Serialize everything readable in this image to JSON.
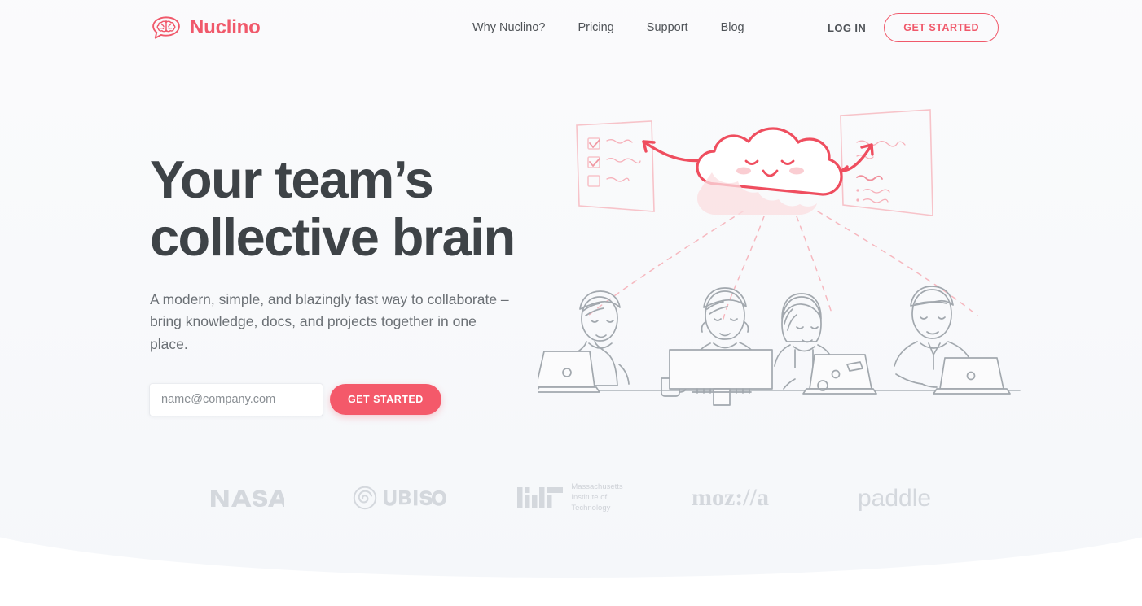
{
  "brand": {
    "name": "Nuclino",
    "icon": "brain-speech-bubble-icon",
    "color": "#f0596b"
  },
  "nav": {
    "items": [
      {
        "label": "Why Nuclino?"
      },
      {
        "label": "Pricing"
      },
      {
        "label": "Support"
      },
      {
        "label": "Blog"
      }
    ]
  },
  "header_actions": {
    "login_label": "LOG IN",
    "get_started_label": "GET STARTED"
  },
  "hero": {
    "headline_line1": "Your team’s",
    "headline_line2": "collective brain",
    "subhead_line1": "A modern, simple, and blazingly fast way to collaborate –",
    "subhead_line2": "bring knowledge, docs, and projects together in one place.",
    "email_placeholder": "name@company.com",
    "email_value": "",
    "cta_label": "GET STARTED"
  },
  "illustration": {
    "alt": "Smiling cloud mascot connected by dashed arcs to four people working on laptops, flanked by a checklist card and a notes card",
    "cloud_color": "#ef4e5f",
    "arc_color": "#f6b8bf",
    "people_color": "#9aa0a6",
    "card_color": "#f7c3c9"
  },
  "logos": {
    "items": [
      {
        "name": "nasa-logo",
        "label": "NASA"
      },
      {
        "name": "ubisoft-logo",
        "label": "UBISOFT"
      },
      {
        "name": "mit-logo",
        "label": "MIT",
        "sub_line1": "Massachusetts",
        "sub_line2": "Institute of",
        "sub_line3": "Technology"
      },
      {
        "name": "mozilla-logo",
        "label": "moz://a"
      },
      {
        "name": "paddle-logo",
        "label": "paddle"
      }
    ],
    "color": "#d3d7dc"
  },
  "colors": {
    "accent": "#f0596b",
    "cta": "#f4596a",
    "heading": "#3e4347",
    "body_text": "#6b7075",
    "background": "#f8f9fb"
  }
}
